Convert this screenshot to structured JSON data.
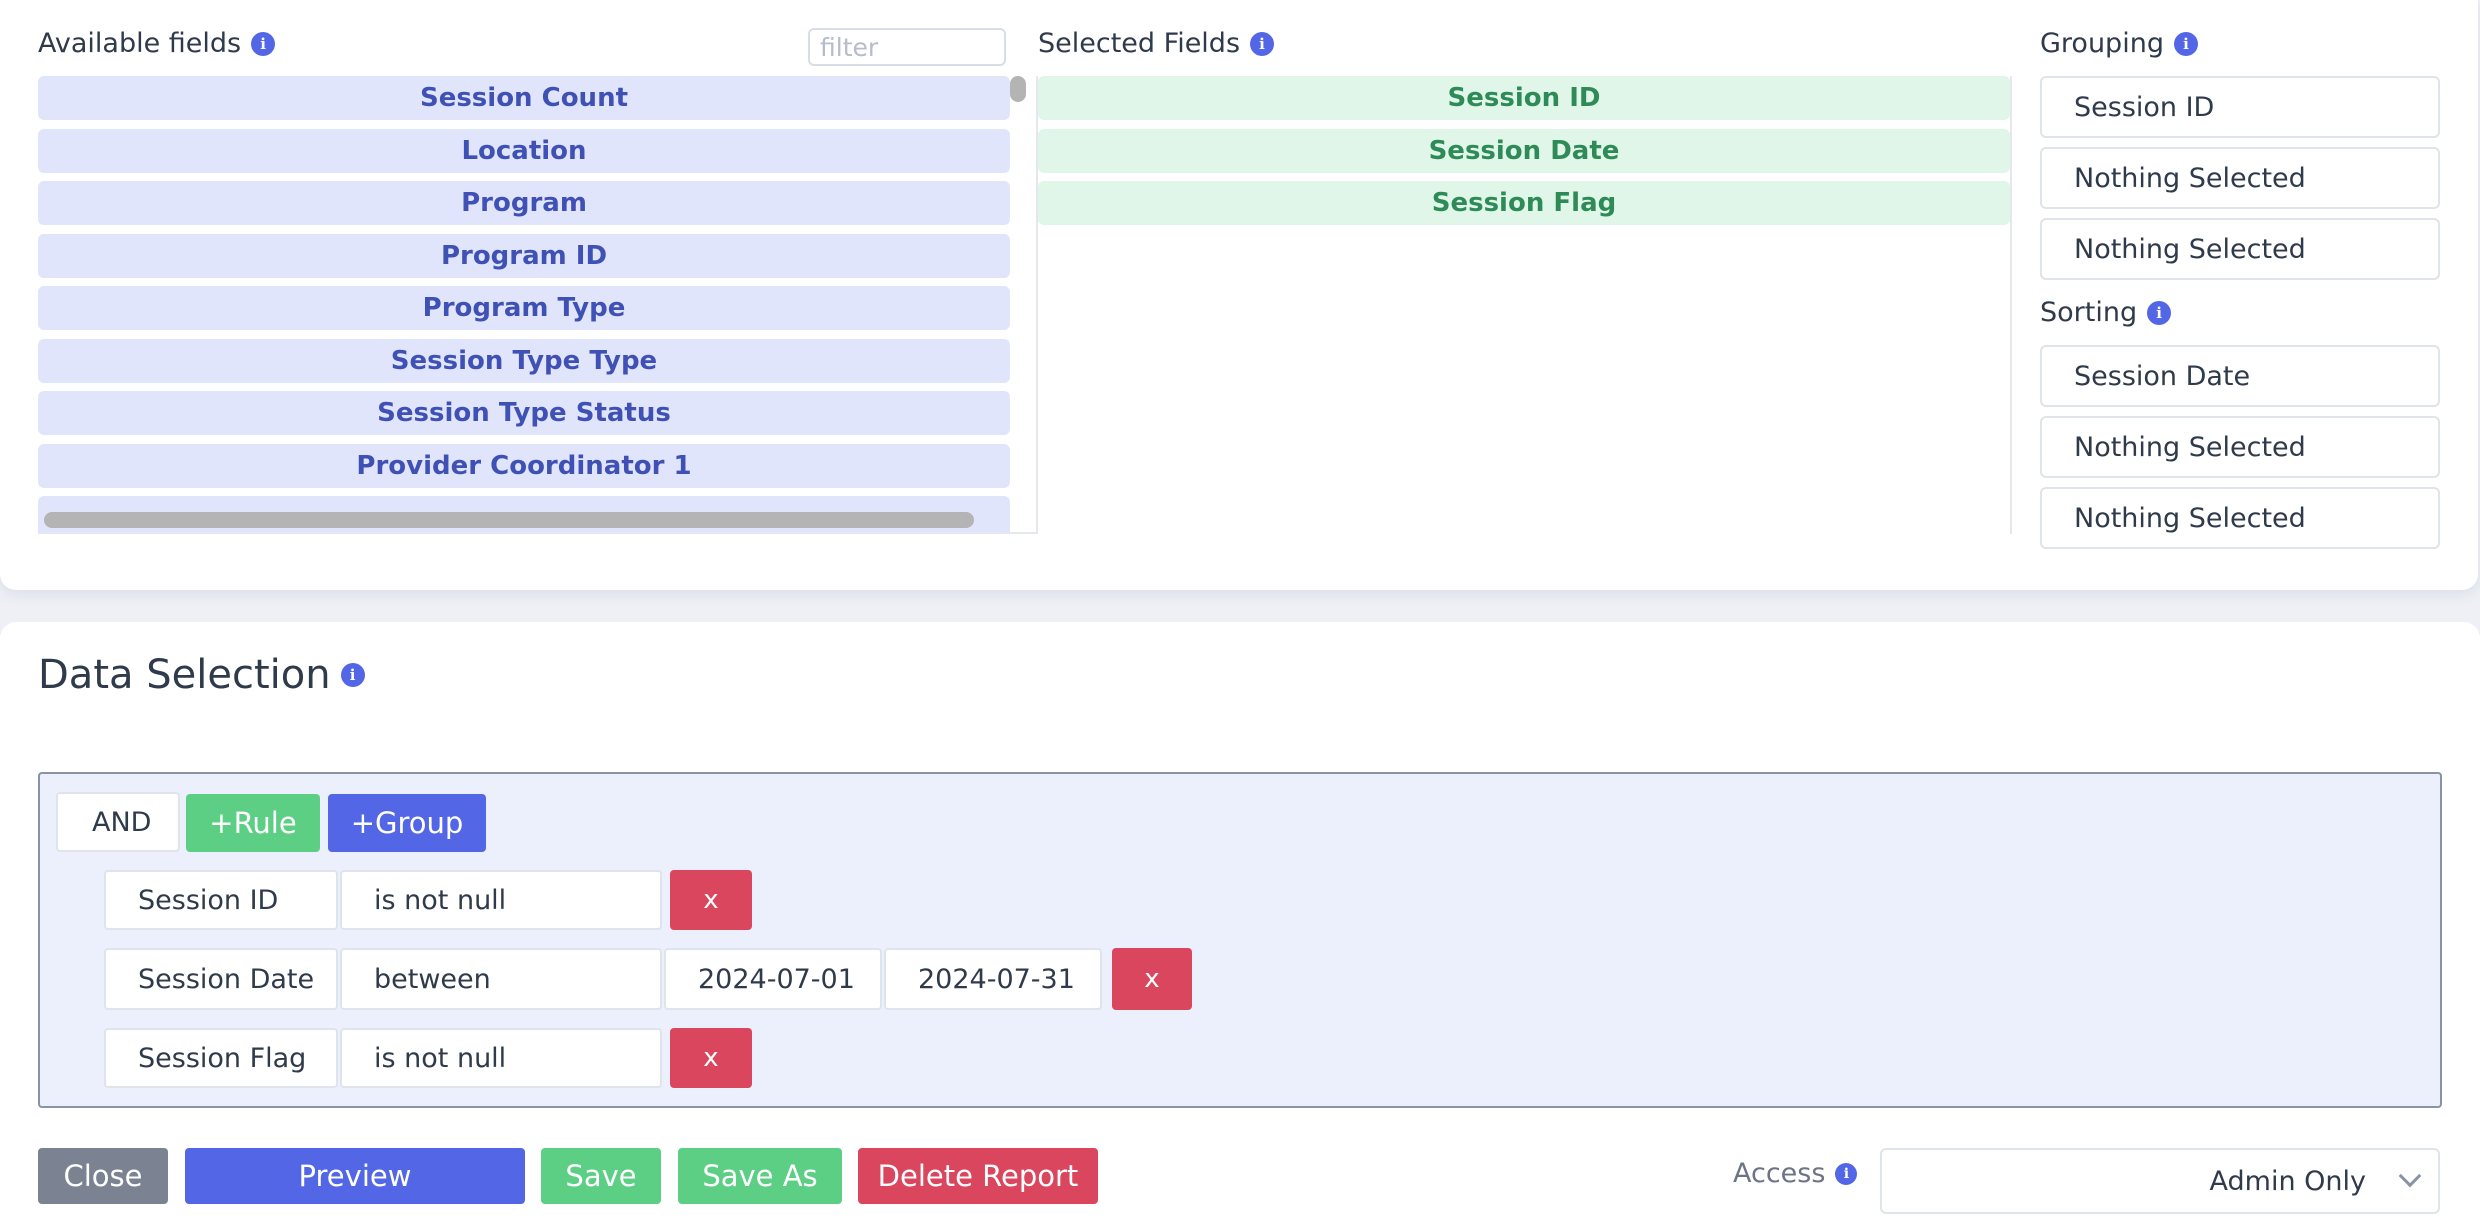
{
  "available": {
    "title": "Available fields",
    "filter_placeholder": "filter",
    "fields": [
      "Session Count",
      "Location",
      "Program",
      "Program ID",
      "Program Type",
      "Session Type Type",
      "Session Type Status",
      "Provider Coordinator 1"
    ]
  },
  "selected": {
    "title": "Selected Fields",
    "fields": [
      "Session ID",
      "Session Date",
      "Session Flag"
    ]
  },
  "grouping": {
    "title": "Grouping",
    "items": [
      "Session ID",
      "Nothing Selected",
      "Nothing Selected"
    ]
  },
  "sorting": {
    "title": "Sorting",
    "items": [
      "Session Date",
      "Nothing Selected",
      "Nothing Selected"
    ]
  },
  "data_selection": {
    "title": "Data Selection",
    "condition": "AND",
    "add_rule": "+Rule",
    "add_group": "+Group",
    "rules": [
      {
        "field": "Session ID",
        "operator": "is not null",
        "remove": "x"
      },
      {
        "field": "Session Date",
        "operator": "between",
        "value1": "2024-07-01",
        "value2": "2024-07-31",
        "remove": "x"
      },
      {
        "field": "Session Flag",
        "operator": "is not null",
        "remove": "x"
      }
    ]
  },
  "actions": {
    "close": "Close",
    "preview": "Preview",
    "save": "Save",
    "save_as": "Save As",
    "delete": "Delete Report"
  },
  "access": {
    "label": "Access",
    "value": "Admin Only"
  },
  "info_glyph": "i",
  "colors": {
    "primary": "#5367e6",
    "success": "#5ccf85",
    "danger": "#d9465d",
    "secondary": "#7b8392",
    "available_bg": "#e1e5fb",
    "selected_bg": "#dff6e9"
  }
}
